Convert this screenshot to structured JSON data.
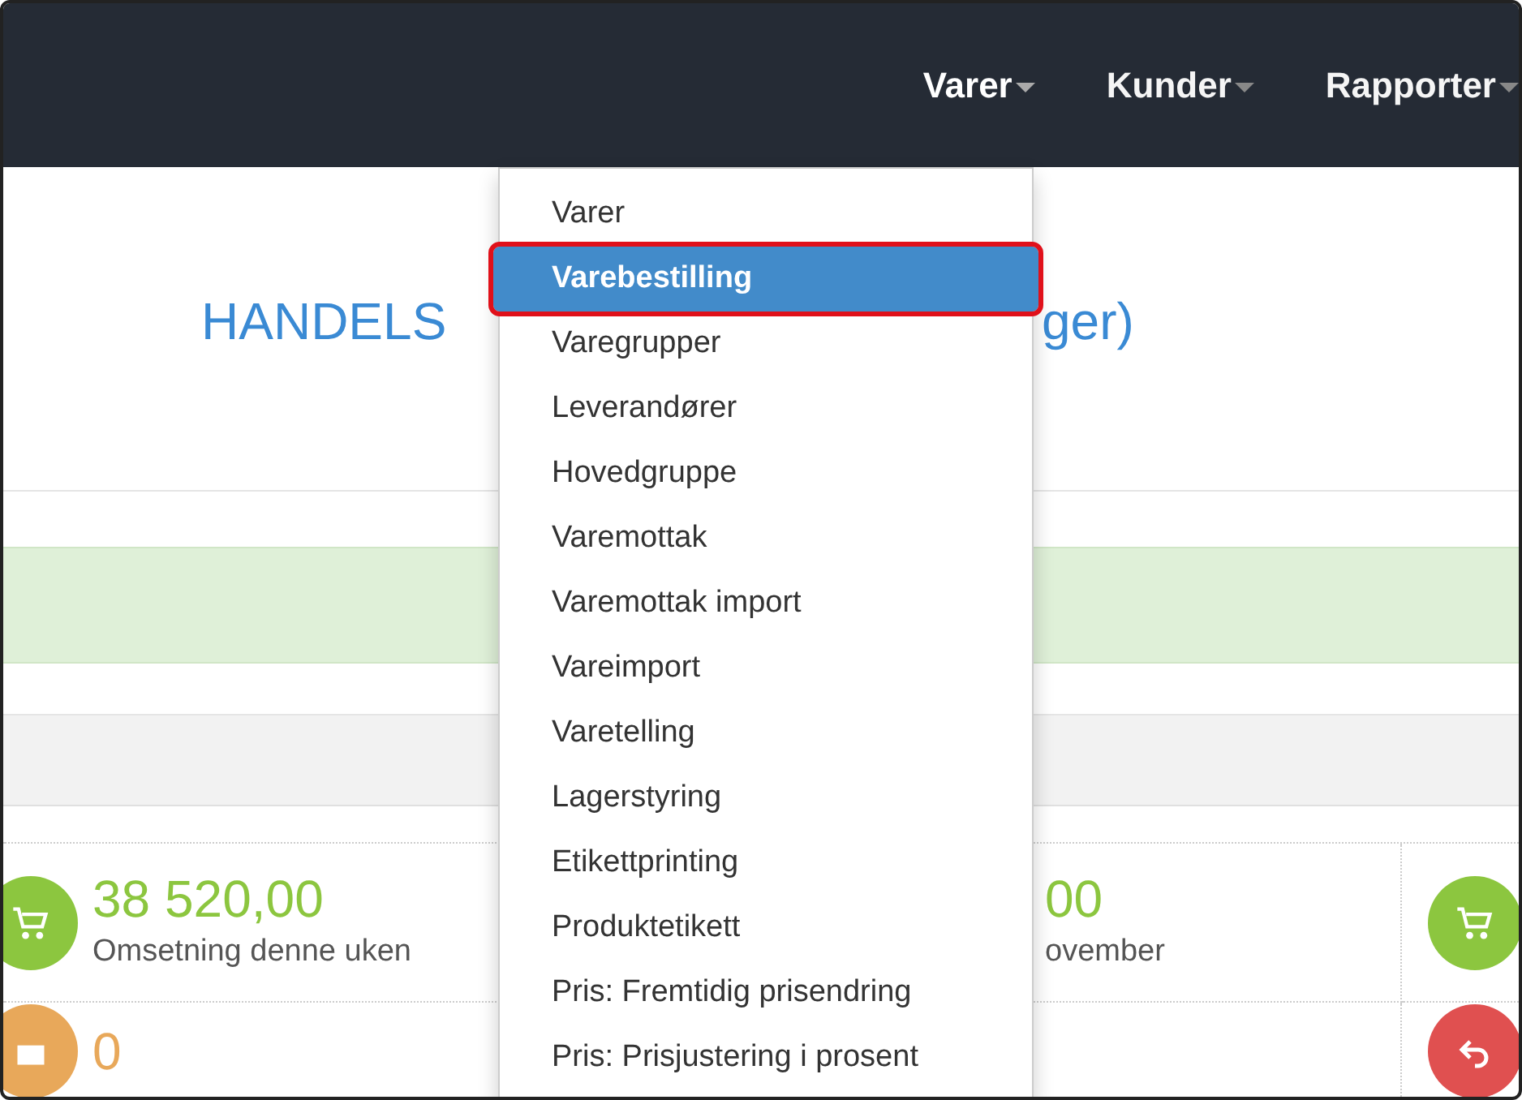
{
  "navbar": {
    "menus": [
      {
        "label": "Varer",
        "open": true
      },
      {
        "label": "Kunder",
        "open": false
      },
      {
        "label": "Rapporter",
        "open": false
      }
    ]
  },
  "heading": {
    "visible_start": "HANDELS",
    "visible_end": "ger)"
  },
  "stats": [
    {
      "kind": "cart",
      "color": "#8cc63f",
      "value": "38 520,00",
      "label": "Omsetning denne uken"
    },
    {
      "kind": "partial",
      "color": "#8cc63f",
      "value": "00",
      "label": "ovember"
    },
    {
      "kind": "cart-icon-only",
      "color": "#8cc63f"
    },
    {
      "kind": "box",
      "color": "#e8a85a",
      "value": "0"
    },
    {
      "kind": "blank"
    },
    {
      "kind": "undo-icon-only",
      "color": "#e05050"
    }
  ],
  "dropdown": {
    "items": [
      {
        "label": "Varer",
        "selected": false
      },
      {
        "label": "Varebestilling",
        "selected": true
      },
      {
        "label": "Varegrupper",
        "selected": false
      },
      {
        "label": "Leverandører",
        "selected": false
      },
      {
        "label": "Hovedgruppe",
        "selected": false
      },
      {
        "label": "Varemottak",
        "selected": false
      },
      {
        "label": "Varemottak import",
        "selected": false
      },
      {
        "label": "Vareimport",
        "selected": false
      },
      {
        "label": "Varetelling",
        "selected": false
      },
      {
        "label": "Lagerstyring",
        "selected": false
      },
      {
        "label": "Etikettprinting",
        "selected": false
      },
      {
        "label": "Produktetikett",
        "selected": false
      },
      {
        "label": "Pris: Fremtidig prisendring",
        "selected": false
      },
      {
        "label": "Pris: Prisjustering i prosent",
        "selected": false
      }
    ]
  }
}
